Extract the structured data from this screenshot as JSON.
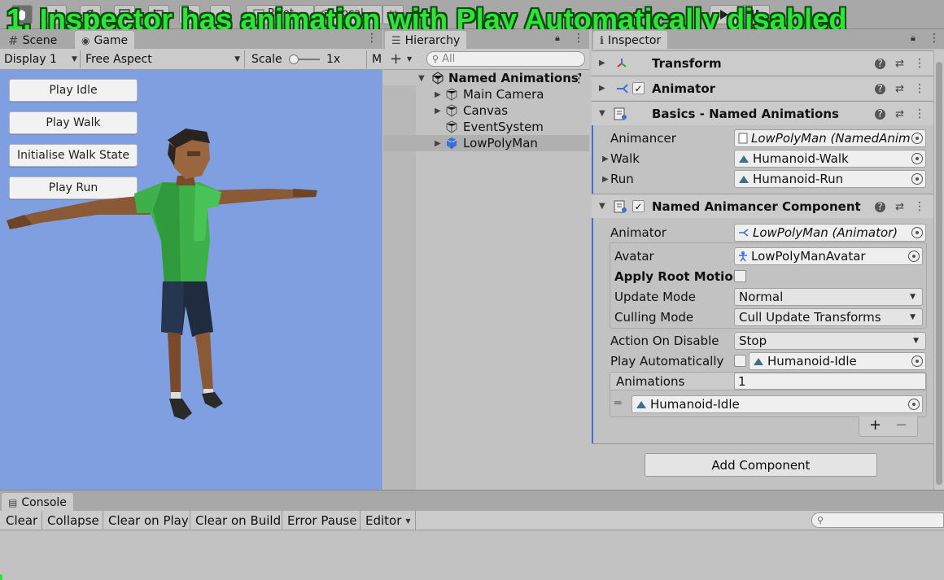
{
  "banner": {
    "text": "1. Inspector has animation with Play Automatically disabled"
  },
  "toolbar": {
    "pivot_label": "Pivot",
    "local_label": "Local",
    "tools": [
      "hand-tool",
      "move-tool",
      "rotate-tool",
      "scale-tool",
      "rect-tool",
      "transform-tool",
      "custom-tool"
    ]
  },
  "tabs": {
    "scene": "Scene",
    "game": "Game",
    "hierarchy": "Hierarchy",
    "inspector": "Inspector"
  },
  "game_toolbar": {
    "display": "Display 1",
    "aspect": "Free Aspect",
    "scale_label": "Scale",
    "scale_value": "1x",
    "more": "M"
  },
  "game_buttons": [
    "Play Idle",
    "Play Walk",
    "Initialise Walk State",
    "Play Run"
  ],
  "hierarchy": {
    "search_placeholder": "All",
    "scene_name": "Named Animations'",
    "items": [
      "Main Camera",
      "Canvas",
      "EventSystem",
      "LowPolyMan"
    ]
  },
  "inspector": {
    "components": {
      "transform": "Transform",
      "animator": "Animator",
      "basics": "Basics - Named Animations",
      "named_animancer": "Named Animancer Component"
    },
    "basics_fields": {
      "animancer_label": "Animancer",
      "animancer_value": "LowPolyMan (NamedAnimancerComponent)",
      "walk_label": "Walk",
      "walk_value": "Humanoid-Walk",
      "run_label": "Run",
      "run_value": "Humanoid-Run"
    },
    "named_fields": {
      "animator_label": "Animator",
      "animator_value": "LowPolyMan (Animator)",
      "avatar_label": "Avatar",
      "avatar_value": "LowPolyManAvatar",
      "apply_root_motion_label": "Apply Root Motion",
      "update_mode_label": "Update Mode",
      "update_mode_value": "Normal",
      "culling_mode_label": "Culling Mode",
      "culling_mode_value": "Cull Update Transforms",
      "action_on_disable_label": "Action On Disable",
      "action_on_disable_value": "Stop",
      "play_auto_label": "Play Automatically",
      "play_auto_checked": false,
      "play_auto_clip": "Humanoid-Idle",
      "animations_label": "Animations",
      "animations_count": "1",
      "animations_items": [
        "Humanoid-Idle"
      ],
      "add_symbol": "+",
      "remove_symbol": "−"
    },
    "add_component": "Add Component"
  },
  "console": {
    "tab": "Console",
    "buttons": [
      "Clear",
      "Collapse",
      "Clear on Play",
      "Clear on Build",
      "Error Pause",
      "Editor"
    ]
  },
  "colors": {
    "banner_green": "#2ee33a",
    "game_bg": "#7f9fe0",
    "editor_bg": "#c2c2c2",
    "accent_blue": "#3a72d8"
  }
}
